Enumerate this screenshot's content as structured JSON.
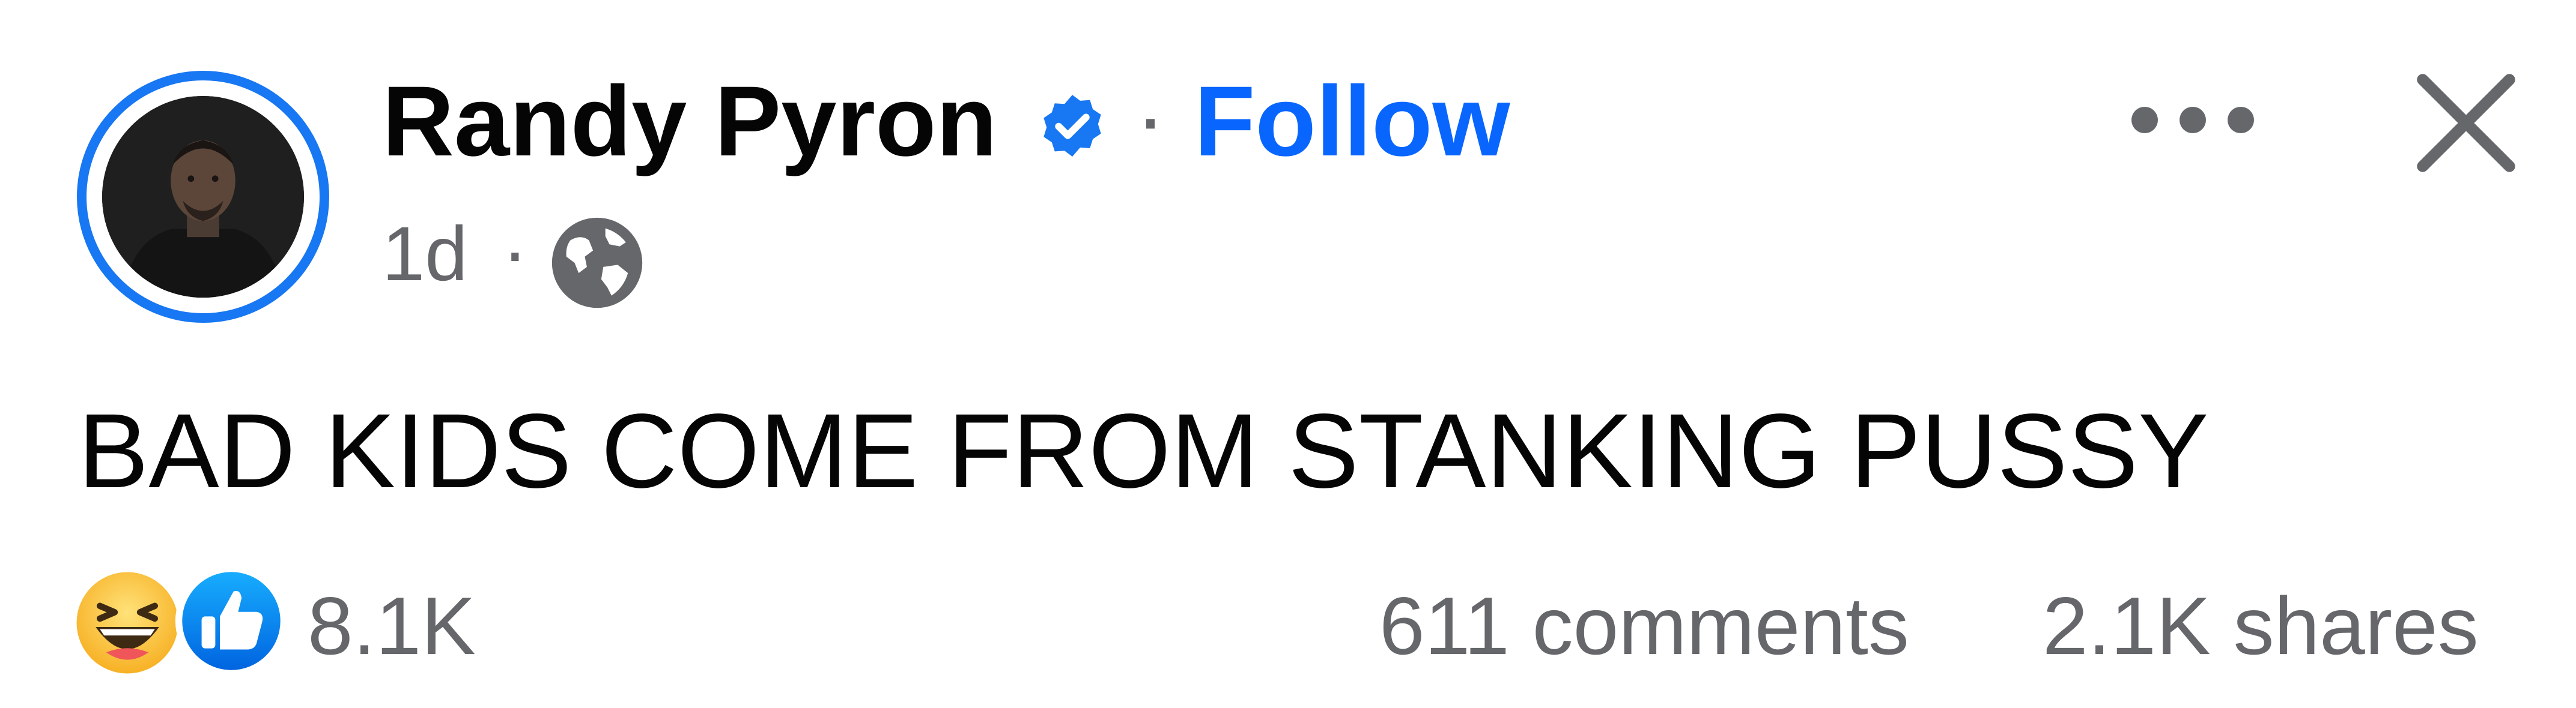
{
  "post": {
    "author": "Randy Pyron",
    "separator": "·",
    "follow_label": "Follow",
    "timestamp": "1d",
    "audience_icon": "globe-icon",
    "text": "BAD KIDS COME FROM STANKING PUSSY"
  },
  "header_actions": {
    "more_icon": "more-options-icon",
    "close_icon": "close-icon"
  },
  "reactions": {
    "icons": [
      "haha-reaction-icon",
      "like-reaction-icon"
    ],
    "count": "8.1K"
  },
  "engagement": {
    "comments": "611 comments",
    "shares": "2.1K shares"
  },
  "colors": {
    "accent": "#1877f2",
    "follow": "#0866ff",
    "text_primary": "#050505",
    "text_secondary": "#65676b"
  }
}
